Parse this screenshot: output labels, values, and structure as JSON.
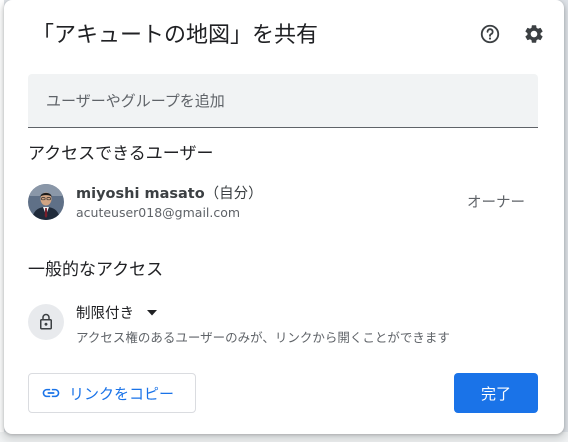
{
  "dialog": {
    "title": "「アキュートの地図」を共有",
    "header_icons": [
      "help-icon",
      "gear-icon"
    ]
  },
  "add_people": {
    "placeholder": "ユーザーやグループを追加"
  },
  "users_section": {
    "title": "アクセスできるユーザー",
    "users": [
      {
        "name": "miyoshi masato",
        "suffix": "（自分）",
        "email": "acuteuser018@gmail.com",
        "role": "オーナー"
      }
    ]
  },
  "general_access": {
    "title": "一般的なアクセス",
    "selected": "制限付き",
    "description": "アクセス権のあるユーザーのみが、リンクから開くことができます",
    "icon": "lock-icon"
  },
  "footer": {
    "copy_link_label": "リンクをコピー",
    "copy_link_icon": "link-icon",
    "done_label": "完了"
  },
  "colors": {
    "accent": "#1a73e8",
    "text": "#202124",
    "secondary_text": "#5f6368",
    "input_bg": "#f1f3f4"
  }
}
